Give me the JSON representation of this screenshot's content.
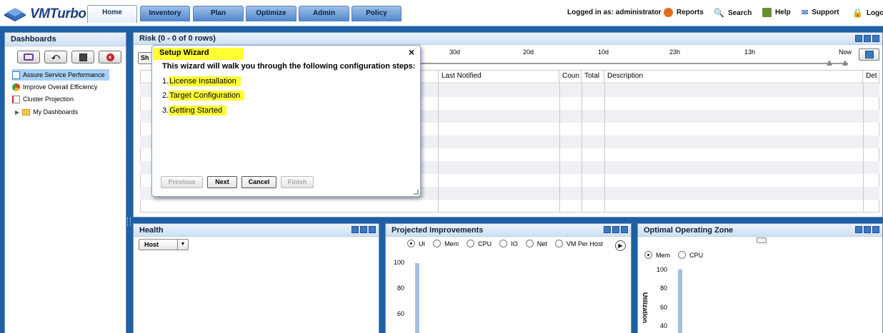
{
  "app": {
    "brand": "VMTurbo",
    "logo_text": "VMTurbo",
    "nav_tabs": [
      "Home",
      "Inventory",
      "Plan",
      "Optimize",
      "Admin",
      "Policy"
    ],
    "active_tab": "Home",
    "logged_in": "Logged in as: administrator",
    "links": {
      "reports": "Reports",
      "search": "Search",
      "help": "Help",
      "support": "Support",
      "logout": "Logout"
    }
  },
  "sidebar": {
    "title": "Dashboards",
    "items": [
      {
        "label": "Assure Service Performance",
        "selected": true
      },
      {
        "label": "Improve Overall Efficiency",
        "selected": false
      },
      {
        "label": "Cluster Projection",
        "selected": false
      },
      {
        "label": "My Dashboards",
        "selected": false
      }
    ]
  },
  "risk": {
    "title": "Risk (0 - 0 of 0 rows)",
    "left_btn": "Sh",
    "timeline": [
      "30d",
      "20d",
      "10d",
      "23h",
      "13h",
      "Now"
    ],
    "columns": [
      "Last Notified",
      "Coun",
      "Total",
      "Description",
      "Det"
    ]
  },
  "wizard": {
    "title": "Setup Wizard",
    "intro": "This wizard will walk you through the following configuration steps:",
    "steps": [
      {
        "num": "1.",
        "label": "License Installation"
      },
      {
        "num": "2.",
        "label": "Target Configuration"
      },
      {
        "num": "3.",
        "label": "Getting Started"
      }
    ],
    "buttons": {
      "previous": "Previous",
      "next": "Next",
      "cancel": "Cancel",
      "finish": "Finish"
    }
  },
  "health": {
    "title": "Health",
    "dropdown_value": "Host"
  },
  "projected": {
    "title": "Projected Improvements",
    "options": [
      "UI",
      "Mem",
      "CPU",
      "IO",
      "Net",
      "VM Per Host"
    ],
    "selected": "UI",
    "y_ticks": [
      "100",
      "80",
      "60"
    ]
  },
  "ooz": {
    "title": "Optimal Operating Zone",
    "options": [
      "Mem",
      "CPU"
    ],
    "selected": "Mem",
    "y_ticks": [
      "100",
      "80",
      "60",
      "40"
    ],
    "y_label": "Utilization"
  },
  "colors": {
    "frame": "#1f5fa3",
    "highlight": "#ffff33",
    "selected_item": "#a8d0f4"
  }
}
